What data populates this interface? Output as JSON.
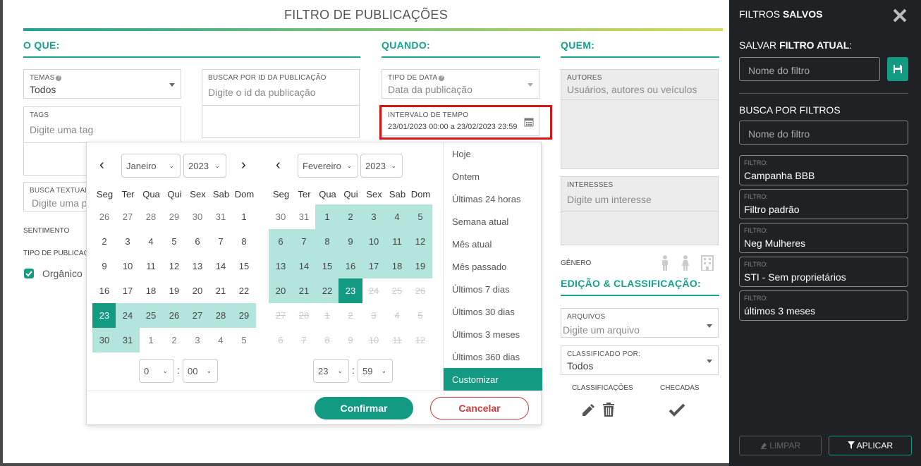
{
  "modal": {
    "title": "FILTRO DE PUBLICAÇÕES",
    "sections": {
      "what": "O QUE:",
      "when": "QUANDO:",
      "who": "QUEM:",
      "edit": "EDIÇÃO & CLASSIFICAÇÃO:"
    },
    "what": {
      "temas_label": "TEMAS",
      "temas_value": "Todos",
      "buscar_label": "BUSCAR POR ID DA PUBLICAÇÃO",
      "buscar_placeholder": "Digite o id da publicação",
      "tags_label": "TAGS",
      "tags_placeholder": "Digite uma tag",
      "busca_textual_label": "BUSCA TEXTUAL",
      "busca_textual_placeholder": "Digite uma p",
      "sentimento_label": "SENTIMENTO",
      "tipo_publicacao_label": "TIPO DE PUBLICAÇ",
      "organico_label": "Orgânico"
    },
    "when": {
      "tipo_data_label": "TIPO DE DATA",
      "tipo_data_value": "Data da publicação",
      "intervalo_label": "INTERVALO DE TEMPO",
      "intervalo_value": "23/01/2023 00:00 a 23/02/2023 23:59"
    },
    "who": {
      "autores_label": "AUTORES",
      "autores_placeholder": "Usuários, autores ou veículos",
      "interesses_label": "INTERESSES",
      "interesses_placeholder": "Digite um interesse",
      "genero_label": "GÊNERO"
    },
    "edit": {
      "arquivos_label": "ARQUIVOS",
      "arquivos_placeholder": "Digite um arquivo",
      "classificado_label": "CLASSIFICADO POR:",
      "classificado_value": "Todos",
      "classificacoes_label": "CLASSIFICAÇÕES",
      "checadas_label": "CHECADAS"
    }
  },
  "datepicker": {
    "weekdays": [
      "Seg",
      "Ter",
      "Qua",
      "Qui",
      "Sex",
      "Sab",
      "Dom"
    ],
    "left": {
      "month": "Janeiro",
      "year": "2023",
      "hour": "0",
      "minute": "00",
      "rows": [
        [
          {
            "d": "26",
            "s": "o"
          },
          {
            "d": "27",
            "s": "o"
          },
          {
            "d": "28",
            "s": "o"
          },
          {
            "d": "29",
            "s": "o"
          },
          {
            "d": "30",
            "s": "o"
          },
          {
            "d": "31",
            "s": "o"
          },
          {
            "d": "1",
            "s": "n"
          }
        ],
        [
          {
            "d": "2",
            "s": "n"
          },
          {
            "d": "3",
            "s": "n"
          },
          {
            "d": "4",
            "s": "n"
          },
          {
            "d": "5",
            "s": "n"
          },
          {
            "d": "6",
            "s": "n"
          },
          {
            "d": "7",
            "s": "n"
          },
          {
            "d": "8",
            "s": "n"
          }
        ],
        [
          {
            "d": "9",
            "s": "n"
          },
          {
            "d": "10",
            "s": "n"
          },
          {
            "d": "11",
            "s": "n"
          },
          {
            "d": "12",
            "s": "n"
          },
          {
            "d": "13",
            "s": "n"
          },
          {
            "d": "14",
            "s": "n"
          },
          {
            "d": "15",
            "s": "n"
          }
        ],
        [
          {
            "d": "16",
            "s": "n"
          },
          {
            "d": "17",
            "s": "n"
          },
          {
            "d": "18",
            "s": "n"
          },
          {
            "d": "19",
            "s": "n"
          },
          {
            "d": "20",
            "s": "n"
          },
          {
            "d": "21",
            "s": "n"
          },
          {
            "d": "22",
            "s": "n"
          }
        ],
        [
          {
            "d": "23",
            "s": "a"
          },
          {
            "d": "24",
            "s": "r"
          },
          {
            "d": "25",
            "s": "r"
          },
          {
            "d": "26",
            "s": "r"
          },
          {
            "d": "27",
            "s": "r"
          },
          {
            "d": "28",
            "s": "r"
          },
          {
            "d": "29",
            "s": "r"
          }
        ],
        [
          {
            "d": "30",
            "s": "r"
          },
          {
            "d": "31",
            "s": "r"
          },
          {
            "d": "1",
            "s": "o"
          },
          {
            "d": "2",
            "s": "o"
          },
          {
            "d": "3",
            "s": "o"
          },
          {
            "d": "4",
            "s": "o"
          },
          {
            "d": "5",
            "s": "o"
          }
        ]
      ]
    },
    "right": {
      "month": "Fevereiro",
      "year": "2023",
      "hour": "23",
      "minute": "59",
      "rows": [
        [
          {
            "d": "30",
            "s": "o"
          },
          {
            "d": "31",
            "s": "o"
          },
          {
            "d": "1",
            "s": "r"
          },
          {
            "d": "2",
            "s": "r"
          },
          {
            "d": "3",
            "s": "r"
          },
          {
            "d": "4",
            "s": "r"
          },
          {
            "d": "5",
            "s": "r"
          }
        ],
        [
          {
            "d": "6",
            "s": "r"
          },
          {
            "d": "7",
            "s": "r"
          },
          {
            "d": "8",
            "s": "r"
          },
          {
            "d": "9",
            "s": "r"
          },
          {
            "d": "10",
            "s": "r"
          },
          {
            "d": "11",
            "s": "r"
          },
          {
            "d": "12",
            "s": "r"
          }
        ],
        [
          {
            "d": "13",
            "s": "r"
          },
          {
            "d": "14",
            "s": "r"
          },
          {
            "d": "15",
            "s": "r"
          },
          {
            "d": "16",
            "s": "r"
          },
          {
            "d": "17",
            "s": "r"
          },
          {
            "d": "18",
            "s": "r"
          },
          {
            "d": "19",
            "s": "r"
          }
        ],
        [
          {
            "d": "20",
            "s": "r"
          },
          {
            "d": "21",
            "s": "r"
          },
          {
            "d": "22",
            "s": "r"
          },
          {
            "d": "23",
            "s": "a"
          },
          {
            "d": "24",
            "s": "d"
          },
          {
            "d": "25",
            "s": "d"
          },
          {
            "d": "26",
            "s": "d"
          }
        ],
        [
          {
            "d": "27",
            "s": "d"
          },
          {
            "d": "28",
            "s": "d"
          },
          {
            "d": "1",
            "s": "d"
          },
          {
            "d": "2",
            "s": "d"
          },
          {
            "d": "3",
            "s": "d"
          },
          {
            "d": "4",
            "s": "d"
          },
          {
            "d": "5",
            "s": "d"
          }
        ],
        [
          {
            "d": "6",
            "s": "d"
          },
          {
            "d": "7",
            "s": "d"
          },
          {
            "d": "8",
            "s": "d"
          },
          {
            "d": "9",
            "s": "d"
          },
          {
            "d": "10",
            "s": "d"
          },
          {
            "d": "11",
            "s": "d"
          },
          {
            "d": "12",
            "s": "d"
          }
        ]
      ]
    },
    "ranges": [
      "Hoje",
      "Ontem",
      "Últimas 24 horas",
      "Semana atual",
      "Mês atual",
      "Mês passado",
      "Últimos 7 dias",
      "Últimos 30 dias",
      "Últimos 3 meses",
      "Últimos 360 dias"
    ],
    "selected_range": "Customizar",
    "confirm": "Confirmar",
    "cancel": "Cancelar"
  },
  "sidebar": {
    "title_a": "FILTROS",
    "title_b": "SALVOS",
    "save_label_a": "SALVAR",
    "save_label_b": "FILTRO ATUAL",
    "save_label_c": ":",
    "save_placeholder": "Nome do filtro",
    "search_label": "BUSCA POR FILTROS",
    "search_placeholder": "Nome do filtro",
    "filter_label": "FILTRO:",
    "filters": [
      "Campanha BBB",
      "Filtro padrão",
      "Neg Mulheres",
      "STI - Sem proprietários",
      "últimos 3 meses"
    ],
    "clear": "LIMPAR",
    "apply": "APLICAR"
  },
  "colors": {
    "accent": "#139a83",
    "range": "#b3e5dc",
    "danger": "#cf3b3b",
    "sidebar": "#1f2125"
  }
}
